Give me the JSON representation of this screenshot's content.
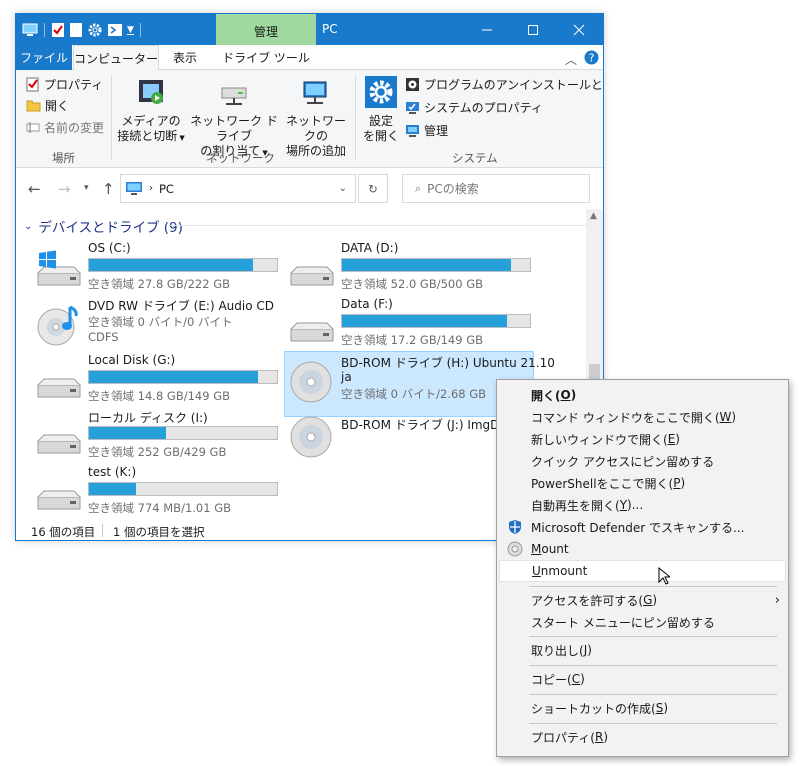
{
  "titlebar": {
    "context_tab": "管理",
    "title": "PC"
  },
  "tabs": {
    "file": "ファイル",
    "computer": "コンピューター",
    "view": "表示",
    "drive_tools": "ドライブ ツール"
  },
  "ribbon": {
    "location": {
      "properties": "プロパティ",
      "open": "開く",
      "rename": "名前の変更",
      "label": "場所"
    },
    "network": {
      "media_l1": "メディアの",
      "media_l2": "接続と切断",
      "map_l1": "ネットワーク ドライブ",
      "map_l2": "の割り当て",
      "add_l1": "ネットワークの",
      "add_l2": "場所の追加",
      "label": "ネットワーク"
    },
    "system": {
      "settings_l1": "設定",
      "settings_l2": "を開く",
      "uninstall": "プログラムのアンインストールと変更",
      "sysprops": "システムのプロパティ",
      "manage": "管理",
      "label": "システム"
    }
  },
  "address": {
    "path": "PC",
    "search_placeholder": "PCの検索"
  },
  "group": {
    "title": "デバイスとドライブ (9)"
  },
  "drives": [
    {
      "name": "OS (C:)",
      "free": "空き領域 27.8 GB/222 GB",
      "used_pct": 87
    },
    {
      "name": "DATA (D:)",
      "free": "空き領域 52.0 GB/500 GB",
      "used_pct": 90
    },
    {
      "name": "DVD RW ドライブ (E:) Audio CD",
      "free": "空き領域 0 バイト/0 バイト",
      "fs": "CDFS"
    },
    {
      "name": "Data (F:)",
      "free": "空き領域 17.2 GB/149 GB",
      "used_pct": 88
    },
    {
      "name": "Local Disk (G:)",
      "free": "空き領域 14.8 GB/149 GB",
      "used_pct": 90
    },
    {
      "name_l1": "BD-ROM ドライブ (H:) Ubuntu 21.10",
      "name_l2": "ja",
      "free": "空き領域 0 バイト/2.68 GB"
    },
    {
      "name": "ローカル ディスク (I:)",
      "free": "空き領域 252 GB/429 GB",
      "used_pct": 41
    },
    {
      "name": "BD-ROM ドライブ (J:) ImgDrive"
    },
    {
      "name": "test (K:)",
      "free": "空き領域 774 MB/1.01 GB",
      "used_pct": 25
    }
  ],
  "status": {
    "count": "16 個の項目",
    "selected": "1 個の項目を選択"
  },
  "menu": {
    "open": {
      "pre": "開く(",
      "key": "O",
      "post": ")"
    },
    "cmd": {
      "pre": "コマンド ウィンドウをここで開く(",
      "key": "W",
      "post": ")"
    },
    "newwin": {
      "pre": "新しいウィンドウで開く(",
      "key": "E",
      "post": ")"
    },
    "pin_quick": "クイック アクセスにピン留めする",
    "powershell": {
      "pre": "PowerShellをここで開く(",
      "key": "P",
      "post": ")"
    },
    "autoplay": {
      "pre": "自動再生を開く(",
      "key": "Y",
      "post": ")..."
    },
    "defender": "Microsoft Defender でスキャンする...",
    "mount": {
      "key": "M",
      "post": "ount"
    },
    "unmount": {
      "key": "U",
      "post": "nmount"
    },
    "access": {
      "pre": "アクセスを許可する(",
      "key": "G",
      "post": ")"
    },
    "pin_start": "スタート メニューにピン留めする",
    "eject": {
      "pre": "取り出し(",
      "key": "J",
      "post": ")"
    },
    "copy": {
      "pre": "コピー(",
      "key": "C",
      "post": ")"
    },
    "shortcut": {
      "pre": "ショートカットの作成(",
      "key": "S",
      "post": ")"
    },
    "properties": {
      "pre": "プロパティ(",
      "key": "R",
      "post": ")"
    }
  }
}
